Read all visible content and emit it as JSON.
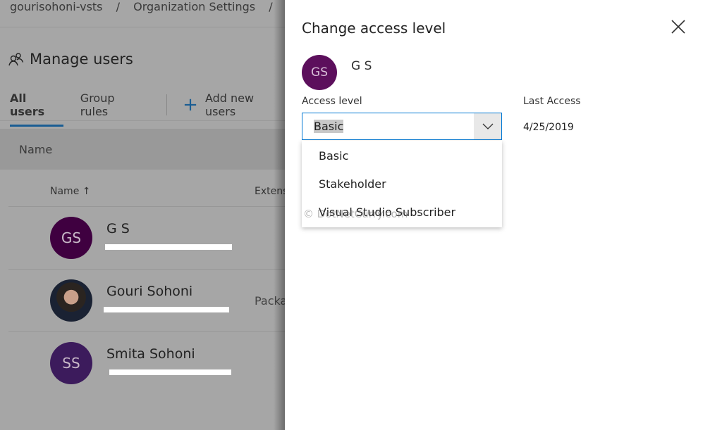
{
  "breadcrumb": [
    "gourisohoni-vsts",
    "/",
    "Organization Settings",
    "/"
  ],
  "page": {
    "title": "Manage users",
    "icon": "people-icon"
  },
  "tabs": [
    {
      "label": "All users",
      "active": true
    },
    {
      "label": "Group rules",
      "active": false
    }
  ],
  "add_users_label": "Add new users",
  "filter_band_label": "Name",
  "columns": {
    "name": "Name ↑",
    "extension": "Extens"
  },
  "users": [
    {
      "initials": "GS",
      "name": "G S",
      "avatar_color": "#3f0040",
      "extension": ""
    },
    {
      "initials": "",
      "name": "Gouri Sohoni",
      "avatar_color": "#1a2233",
      "extension": "Packa"
    },
    {
      "initials": "SS",
      "name": "Smita Sohoni",
      "avatar_color": "#3c1b5c",
      "extension": ""
    }
  ],
  "panel": {
    "title": "Change access level",
    "user": {
      "initials": "GS",
      "name": "G S"
    },
    "access_level_label": "Access level",
    "access_level_value": "Basic",
    "last_access_label": "Last Access",
    "last_access_value": "4/25/2019",
    "options": [
      "Basic",
      "Stakeholder",
      "Visual Studio Subscriber"
    ],
    "accent": "#0078d4"
  },
  "watermark": "© DotNetCurry.com"
}
